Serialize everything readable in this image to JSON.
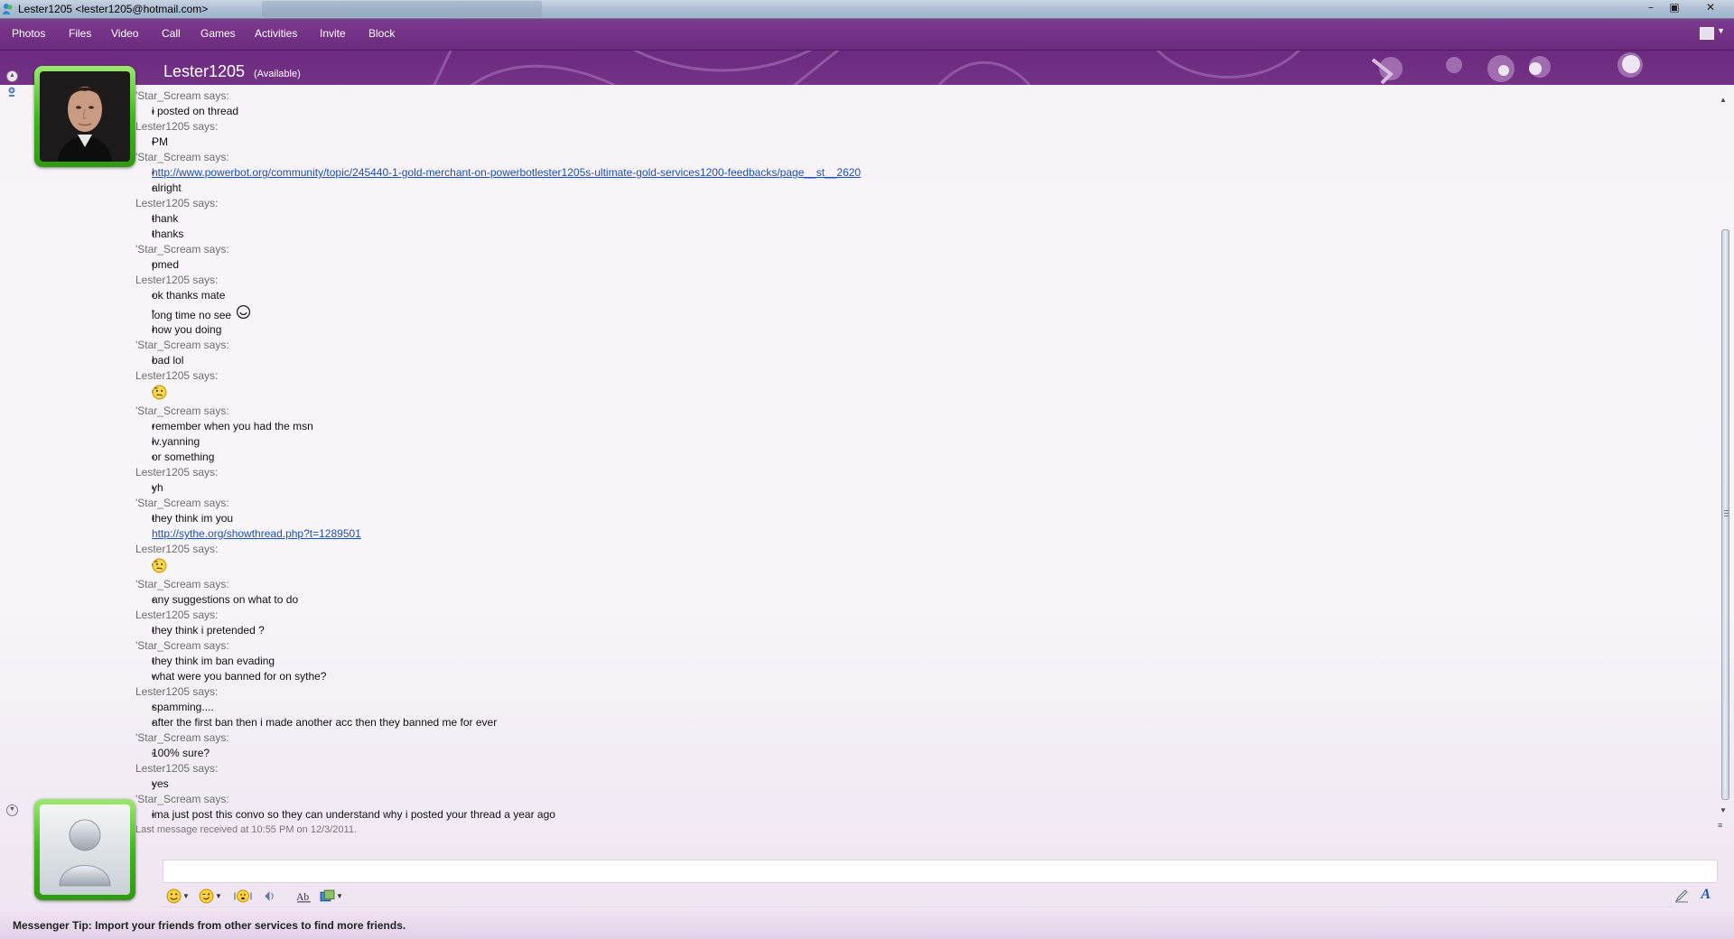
{
  "window": {
    "title": "Lester1205 <lester1205@hotmail.com>",
    "controls": [
      "minimize",
      "restore",
      "close"
    ]
  },
  "menu": {
    "items": [
      "Photos",
      "Files",
      "Video",
      "Call",
      "Games",
      "Activities",
      "Invite",
      "Block"
    ]
  },
  "header": {
    "contact_name": "Lester1205",
    "contact_status": "(Available)"
  },
  "conversation": {
    "lines": [
      {
        "kind": "msg",
        "text": "thanks"
      },
      {
        "kind": "sender",
        "text": "'Star_Scream says:"
      },
      {
        "kind": "msg",
        "text": "i posted on thread"
      },
      {
        "kind": "sender",
        "text": "Lester1205 says:"
      },
      {
        "kind": "msg",
        "text": "PM"
      },
      {
        "kind": "sender",
        "text": "'Star_Scream says:"
      },
      {
        "kind": "link",
        "text": "http://www.powerbot.org/community/topic/245440-1-gold-merchant-on-powerbotlester1205s-ultimate-gold-services1200-feedbacks/page__st__2620"
      },
      {
        "kind": "msg",
        "text": "alright"
      },
      {
        "kind": "sender",
        "text": "Lester1205 says:"
      },
      {
        "kind": "msg",
        "text": "thank"
      },
      {
        "kind": "msg",
        "text": "thanks"
      },
      {
        "kind": "sender",
        "text": "'Star_Scream says:"
      },
      {
        "kind": "msg",
        "text": "pmed"
      },
      {
        "kind": "sender",
        "text": "Lester1205 says:"
      },
      {
        "kind": "msg",
        "text": "ok thanks mate"
      },
      {
        "kind": "msg",
        "text": "long time no see",
        "emoticon": "smile"
      },
      {
        "kind": "msg",
        "text": "how you doing"
      },
      {
        "kind": "sender",
        "text": "'Star_Scream says:"
      },
      {
        "kind": "msg",
        "text": "bad lol"
      },
      {
        "kind": "sender",
        "text": "Lester1205 says:"
      },
      {
        "kind": "msg",
        "text": "",
        "emoticon": "thinking"
      },
      {
        "kind": "sender",
        "text": "'Star_Scream says:"
      },
      {
        "kind": "msg",
        "text": "remember when you had the msn"
      },
      {
        "kind": "msg",
        "text": "lv.yanning"
      },
      {
        "kind": "msg",
        "text": "or something"
      },
      {
        "kind": "sender",
        "text": "Lester1205 says:"
      },
      {
        "kind": "msg",
        "text": "yh"
      },
      {
        "kind": "sender",
        "text": "'Star_Scream says:"
      },
      {
        "kind": "msg",
        "text": "they think im you"
      },
      {
        "kind": "link-nobullet",
        "text": "http://sythe.org/showthread.php?t=1289501"
      },
      {
        "kind": "sender",
        "text": "Lester1205 says:"
      },
      {
        "kind": "msg",
        "text": "",
        "emoticon": "thinking"
      },
      {
        "kind": "sender",
        "text": "'Star_Scream says:"
      },
      {
        "kind": "msg",
        "text": "any suggestions on what to do"
      },
      {
        "kind": "sender",
        "text": "Lester1205 says:"
      },
      {
        "kind": "msg",
        "text": "they think i pretended  ?"
      },
      {
        "kind": "sender",
        "text": "'Star_Scream says:"
      },
      {
        "kind": "msg",
        "text": "they think im ban evading"
      },
      {
        "kind": "msg",
        "text": "what were you banned for on sythe?"
      },
      {
        "kind": "sender",
        "text": "Lester1205 says:"
      },
      {
        "kind": "msg",
        "text": "spamming...."
      },
      {
        "kind": "msg",
        "text": "after the first ban then i made another acc then they banned me for ever"
      },
      {
        "kind": "sender",
        "text": "'Star_Scream says:"
      },
      {
        "kind": "msg",
        "text": "100% sure?"
      },
      {
        "kind": "sender",
        "text": "Lester1205 says:"
      },
      {
        "kind": "msg",
        "text": "yes"
      },
      {
        "kind": "sender",
        "text": "'Star_Scream says:"
      },
      {
        "kind": "msg",
        "text": "ima just post this convo so they can understand why i posted your thread a year ago"
      },
      {
        "kind": "timestamp",
        "text": "Last message received at 10:55 PM on 12/3/2011."
      }
    ]
  },
  "input": {
    "value": ""
  },
  "tip": {
    "text": "Messenger Tip: Import your friends from other services to find more friends."
  },
  "colors": {
    "menu_bg": "#6b2b7e",
    "link": "#1a4fc0",
    "avatar_frame": "#3fb91a",
    "sender_text": "#6e6e6e"
  }
}
